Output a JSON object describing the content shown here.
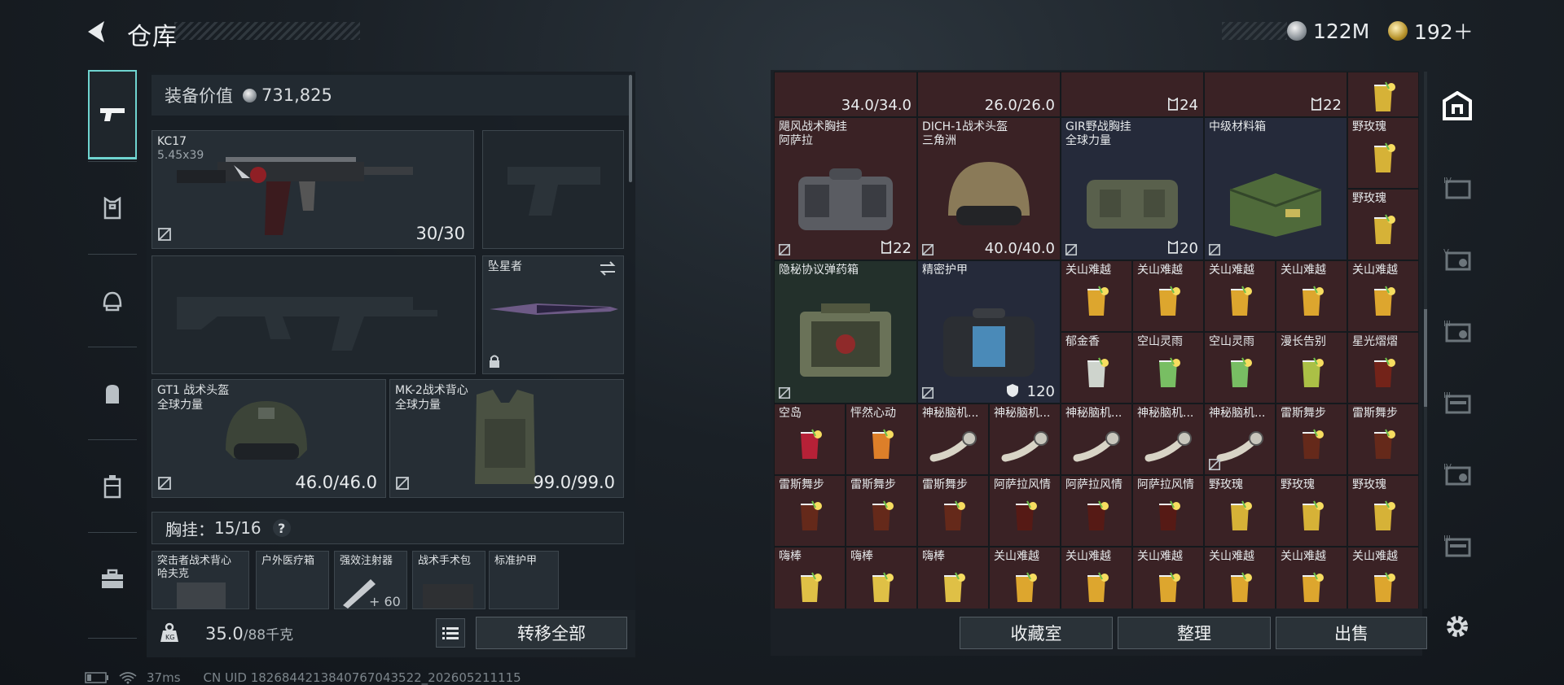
{
  "header": {
    "title": "仓库",
    "currency": [
      {
        "value": "122M",
        "icon": "silver-coin-icon"
      },
      {
        "value": "192＋",
        "icon": "gold-coin-icon"
      }
    ]
  },
  "left_sidebar": [
    "pistol-icon",
    "armor-rig-icon",
    "helmet-icon",
    "backpack-icon",
    "case-icon",
    "toolbox-icon"
  ],
  "loadout": {
    "equip_value_label": "装备价值",
    "equip_value": "731,825",
    "primary": {
      "name": "KC17",
      "caliber": "5.45x39",
      "ammo": "30/30"
    },
    "melee": {
      "name": "坠星者"
    },
    "helmet": {
      "name": "GT1 战术头盔",
      "sub": "全球力量",
      "durability": "46.0/46.0"
    },
    "armor": {
      "name": "MK-2战术背心",
      "sub": "全球力量",
      "durability": "99.0/99.0"
    },
    "rig_label": "胸挂：",
    "rig_count": "15/16",
    "rig_help": "?",
    "rig_items": [
      {
        "name": "突击者战术背心",
        "sub": "哈夫克"
      },
      {
        "name": "户外医疗箱"
      },
      {
        "name": "强效注射器",
        "val": "+ 60"
      },
      {
        "name": "战术手术包"
      },
      {
        "name": "标准护甲"
      }
    ],
    "weight": "35.0",
    "weight_max": "/88千克",
    "transfer_all": "转移全部"
  },
  "stash": {
    "rows": [
      [
        {
          "w": 2,
          "h": 0.6,
          "color": "red",
          "val": "34.0/34.0"
        },
        {
          "w": 2,
          "h": 0.6,
          "color": "red",
          "val": "26.0/26.0"
        },
        {
          "w": 2,
          "h": 0.6,
          "color": "red",
          "val": "24",
          "icon": "rig"
        },
        {
          "w": 2,
          "h": 0.6,
          "color": "red",
          "val": "22",
          "icon": "rig"
        },
        {
          "w": 1,
          "h": 0.6,
          "color": "red"
        }
      ]
    ],
    "items": [
      {
        "name": "飓风战术胸挂",
        "sub": "阿萨拉",
        "val": "22",
        "rig": true
      },
      {
        "name": "DICH-1战术头盔",
        "sub": "三角洲",
        "val": "40.0/40.0"
      },
      {
        "name": "GIR野战胸挂",
        "sub": "全球力量",
        "val": "20",
        "rig": true
      },
      {
        "name": "中级材料箱"
      },
      {
        "name": "野玫瑰"
      },
      {
        "name": "野玫瑰"
      },
      {
        "name": "隐秘协议弹药箱"
      },
      {
        "name": "精密护甲",
        "val": "120"
      },
      {
        "name": "关山难越"
      },
      {
        "name": "关山难越"
      },
      {
        "name": "关山难越"
      },
      {
        "name": "关山难越"
      },
      {
        "name": "关山难越"
      },
      {
        "name": "郁金香"
      },
      {
        "name": "空山灵雨"
      },
      {
        "name": "空山灵雨"
      },
      {
        "name": "漫长告别"
      },
      {
        "name": "星光熠熠"
      },
      {
        "name": "空岛"
      },
      {
        "name": "怦然心动"
      },
      {
        "name": "神秘脑机..."
      },
      {
        "name": "神秘脑机..."
      },
      {
        "name": "神秘脑机..."
      },
      {
        "name": "神秘脑机..."
      },
      {
        "name": "神秘脑机..."
      },
      {
        "name": "雷斯舞步"
      },
      {
        "name": "雷斯舞步"
      },
      {
        "name": "雷斯舞步"
      },
      {
        "name": "雷斯舞步"
      },
      {
        "name": "雷斯舞步"
      },
      {
        "name": "阿萨拉风情"
      },
      {
        "name": "阿萨拉风情"
      },
      {
        "name": "阿萨拉风情"
      },
      {
        "name": "野玫瑰"
      },
      {
        "name": "野玫瑰"
      },
      {
        "name": "野玫瑰"
      },
      {
        "name": "嗨棒"
      },
      {
        "name": "嗨棒"
      },
      {
        "name": "嗨棒"
      },
      {
        "name": "关山难越"
      },
      {
        "name": "关山难越"
      },
      {
        "name": "关山难越"
      },
      {
        "name": "关山难越"
      },
      {
        "name": "关山难越"
      },
      {
        "name": "关山难越"
      }
    ],
    "buttons": {
      "collection": "收藏室",
      "organize": "整理",
      "sell": "出售"
    }
  },
  "right_sidebar": [
    "stash-main-icon",
    "stash-iv-icon",
    "stash-v-icon",
    "stash-iii-icon",
    "stash-iii-b-icon",
    "stash-iv-b-icon",
    "stash-iii-c-icon"
  ],
  "status": {
    "ping": "37ms",
    "uid": "CN UID 1826844213840767043522_202605211115"
  }
}
